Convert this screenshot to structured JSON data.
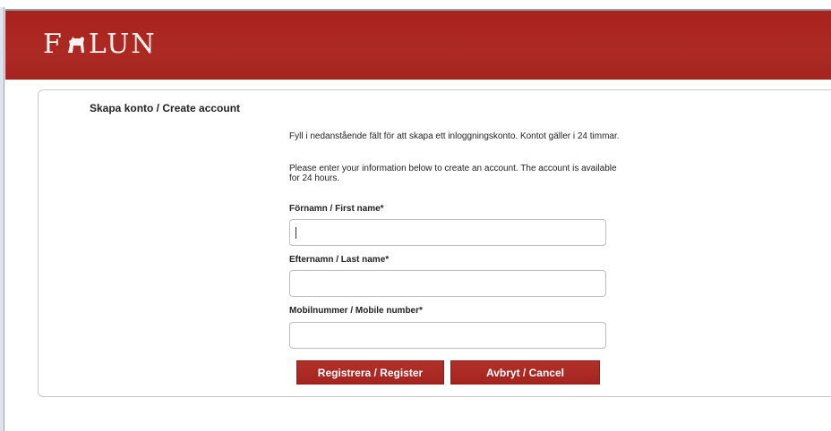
{
  "app": {
    "logo_text_left": "F",
    "logo_text_right": "LUN"
  },
  "colors": {
    "brand_red": "#a8211d",
    "button_red": "#a52420"
  },
  "form": {
    "title": "Skapa konto / Create account",
    "intro_sv": "Fyll i nedanstående fält för att skapa ett inloggningskonto. Kontot gäller i 24 timmar.",
    "intro_en": "Please enter your information below to create an account. The account is available for 24 hours.",
    "fields": [
      {
        "label": "Förnamn / First name*",
        "value": ""
      },
      {
        "label": "Efternamn / Last name*",
        "value": ""
      },
      {
        "label": "Mobilnummer / Mobile number*",
        "value": ""
      }
    ],
    "register_label": "Registrera / Register",
    "cancel_label": "Avbryt / Cancel"
  },
  "icons": {
    "logo_mark": "dala-horse-icon"
  }
}
